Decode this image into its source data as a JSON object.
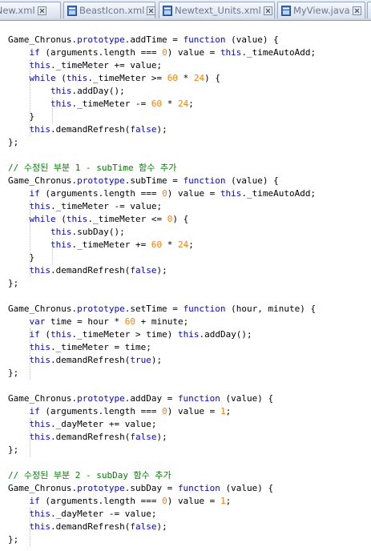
{
  "tabs": [
    {
      "label": "_New.xml"
    },
    {
      "label": "BeastIcon.xml"
    },
    {
      "label": "Newtext_Units.xml"
    },
    {
      "label": "MyView.java"
    }
  ],
  "colors": {
    "keyword": "#0000ff",
    "number": "#ff7f00",
    "comment": "#008000",
    "text": "#000000"
  },
  "code_lines": [
    [
      {
        "t": "Game_Chronus."
      },
      {
        "t": "prototype",
        "c": "kw"
      },
      {
        "t": ".addTime = "
      },
      {
        "t": "function",
        "c": "kw"
      },
      {
        "t": " (value) {"
      }
    ],
    [
      {
        "t": "    "
      },
      {
        "t": "if",
        "c": "kw"
      },
      {
        "t": " (arguments.length === "
      },
      {
        "t": "0",
        "c": "num"
      },
      {
        "t": ") value = "
      },
      {
        "t": "this",
        "c": "kw"
      },
      {
        "t": "._timeAutoAdd;"
      }
    ],
    [
      {
        "t": "    "
      },
      {
        "t": "this",
        "c": "kw"
      },
      {
        "t": "._timeMeter += value;"
      }
    ],
    [
      {
        "t": "    "
      },
      {
        "t": "while",
        "c": "kw"
      },
      {
        "t": " ("
      },
      {
        "t": "this",
        "c": "kw"
      },
      {
        "t": "._timeMeter >= "
      },
      {
        "t": "60",
        "c": "num"
      },
      {
        "t": " * "
      },
      {
        "t": "24",
        "c": "num"
      },
      {
        "t": ") {"
      }
    ],
    [
      {
        "t": "        "
      },
      {
        "t": "this",
        "c": "kw"
      },
      {
        "t": ".addDay();"
      }
    ],
    [
      {
        "t": "        "
      },
      {
        "t": "this",
        "c": "kw"
      },
      {
        "t": "._timeMeter -= "
      },
      {
        "t": "60",
        "c": "num"
      },
      {
        "t": " * "
      },
      {
        "t": "24",
        "c": "num"
      },
      {
        "t": ";"
      }
    ],
    [
      {
        "t": "    }"
      }
    ],
    [
      {
        "t": "    "
      },
      {
        "t": "this",
        "c": "kw"
      },
      {
        "t": ".demandRefresh("
      },
      {
        "t": "false",
        "c": "kw"
      },
      {
        "t": ");"
      }
    ],
    [
      {
        "t": "};"
      }
    ],
    [],
    [
      {
        "t": "// 수정된 부분 1 - subTime 함수 추가",
        "c": "cm"
      }
    ],
    [
      {
        "t": "Game_Chronus."
      },
      {
        "t": "prototype",
        "c": "kw"
      },
      {
        "t": ".subTime = "
      },
      {
        "t": "function",
        "c": "kw"
      },
      {
        "t": " (value) {"
      }
    ],
    [
      {
        "t": "    "
      },
      {
        "t": "if",
        "c": "kw"
      },
      {
        "t": " (arguments.length === "
      },
      {
        "t": "0",
        "c": "num"
      },
      {
        "t": ") value = "
      },
      {
        "t": "this",
        "c": "kw"
      },
      {
        "t": "._timeAutoAdd;"
      }
    ],
    [
      {
        "t": "    "
      },
      {
        "t": "this",
        "c": "kw"
      },
      {
        "t": "._timeMeter -= value;"
      }
    ],
    [
      {
        "t": "    "
      },
      {
        "t": "while",
        "c": "kw"
      },
      {
        "t": " ("
      },
      {
        "t": "this",
        "c": "kw"
      },
      {
        "t": "._timeMeter <= "
      },
      {
        "t": "0",
        "c": "num"
      },
      {
        "t": ") {"
      }
    ],
    [
      {
        "t": "        "
      },
      {
        "t": "this",
        "c": "kw"
      },
      {
        "t": ".subDay();"
      }
    ],
    [
      {
        "t": "        "
      },
      {
        "t": "this",
        "c": "kw"
      },
      {
        "t": "._timeMeter += "
      },
      {
        "t": "60",
        "c": "num"
      },
      {
        "t": " * "
      },
      {
        "t": "24",
        "c": "num"
      },
      {
        "t": ";"
      }
    ],
    [
      {
        "t": "    }"
      }
    ],
    [
      {
        "t": "    "
      },
      {
        "t": "this",
        "c": "kw"
      },
      {
        "t": ".demandRefresh("
      },
      {
        "t": "false",
        "c": "kw"
      },
      {
        "t": ");"
      }
    ],
    [
      {
        "t": "};"
      }
    ],
    [],
    [
      {
        "t": "Game_Chronus."
      },
      {
        "t": "prototype",
        "c": "kw"
      },
      {
        "t": ".setTime = "
      },
      {
        "t": "function",
        "c": "kw"
      },
      {
        "t": " (hour, minute) {"
      }
    ],
    [
      {
        "t": "    "
      },
      {
        "t": "var",
        "c": "kw"
      },
      {
        "t": " time = hour * "
      },
      {
        "t": "60",
        "c": "num"
      },
      {
        "t": " + minute;"
      }
    ],
    [
      {
        "t": "    "
      },
      {
        "t": "if",
        "c": "kw"
      },
      {
        "t": " ("
      },
      {
        "t": "this",
        "c": "kw"
      },
      {
        "t": "._timeMeter > time) "
      },
      {
        "t": "this",
        "c": "kw"
      },
      {
        "t": ".addDay();"
      }
    ],
    [
      {
        "t": "    "
      },
      {
        "t": "this",
        "c": "kw"
      },
      {
        "t": "._timeMeter = time;"
      }
    ],
    [
      {
        "t": "    "
      },
      {
        "t": "this",
        "c": "kw"
      },
      {
        "t": ".demandRefresh("
      },
      {
        "t": "true",
        "c": "kw"
      },
      {
        "t": ");"
      }
    ],
    [
      {
        "t": "};"
      }
    ],
    [],
    [
      {
        "t": "Game_Chronus."
      },
      {
        "t": "prototype",
        "c": "kw"
      },
      {
        "t": ".addDay = "
      },
      {
        "t": "function",
        "c": "kw"
      },
      {
        "t": " (value) {"
      }
    ],
    [
      {
        "t": "    "
      },
      {
        "t": "if",
        "c": "kw"
      },
      {
        "t": " (arguments.length === "
      },
      {
        "t": "0",
        "c": "num"
      },
      {
        "t": ") value = "
      },
      {
        "t": "1",
        "c": "num"
      },
      {
        "t": ";"
      }
    ],
    [
      {
        "t": "    "
      },
      {
        "t": "this",
        "c": "kw"
      },
      {
        "t": "._dayMeter += value;"
      }
    ],
    [
      {
        "t": "    "
      },
      {
        "t": "this",
        "c": "kw"
      },
      {
        "t": ".demandRefresh("
      },
      {
        "t": "false",
        "c": "kw"
      },
      {
        "t": ");"
      }
    ],
    [
      {
        "t": "};"
      }
    ],
    [],
    [
      {
        "t": "// 수정된 부분 2 - subDay 함수 추가",
        "c": "cm"
      }
    ],
    [
      {
        "t": "Game_Chronus."
      },
      {
        "t": "prototype",
        "c": "kw"
      },
      {
        "t": ".subDay = "
      },
      {
        "t": "function",
        "c": "kw"
      },
      {
        "t": " (value) {"
      }
    ],
    [
      {
        "t": "    "
      },
      {
        "t": "if",
        "c": "kw"
      },
      {
        "t": " (arguments.length === "
      },
      {
        "t": "0",
        "c": "num"
      },
      {
        "t": ") value = "
      },
      {
        "t": "1",
        "c": "num"
      },
      {
        "t": ";"
      }
    ],
    [
      {
        "t": "    "
      },
      {
        "t": "this",
        "c": "kw"
      },
      {
        "t": "._dayMeter -= value;"
      }
    ],
    [
      {
        "t": "    "
      },
      {
        "t": "this",
        "c": "kw"
      },
      {
        "t": ".demandRefresh("
      },
      {
        "t": "false",
        "c": "kw"
      },
      {
        "t": ");"
      }
    ],
    [
      {
        "t": "};"
      }
    ]
  ]
}
